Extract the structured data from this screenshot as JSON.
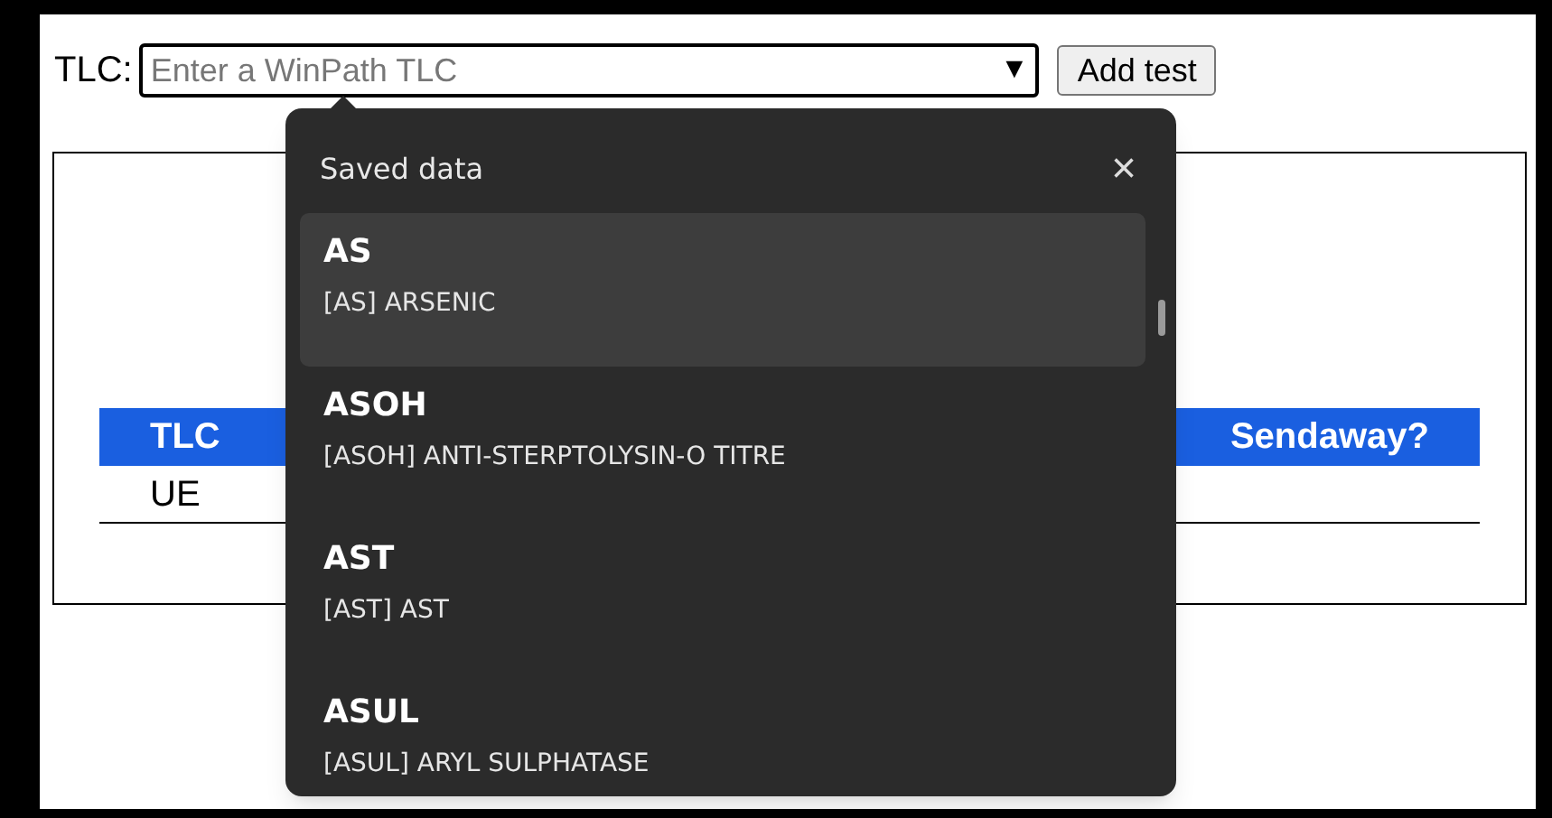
{
  "form": {
    "label": "TLC:",
    "field": {
      "placeholder": "Enter a WinPath TLC",
      "caret": "▼"
    },
    "button": "Add test"
  },
  "table": {
    "columns": [
      "TLC",
      "Sendaway?"
    ],
    "rows": [
      [
        "UE"
      ]
    ]
  },
  "popup": {
    "title": "Saved data",
    "close": "×",
    "items": [
      {
        "code": "AS",
        "name": "[AS] ARSENIC",
        "selected": true
      },
      {
        "code": "ASOH",
        "name": "[ASOH] ANTI-STERPTOLYSIN-O TITRE",
        "selected": false
      },
      {
        "code": "AST",
        "name": "[AST] AST",
        "selected": false
      },
      {
        "code": "ASUL",
        "name": "[ASUL] ARYL SULPHATASE",
        "selected": false
      }
    ]
  }
}
